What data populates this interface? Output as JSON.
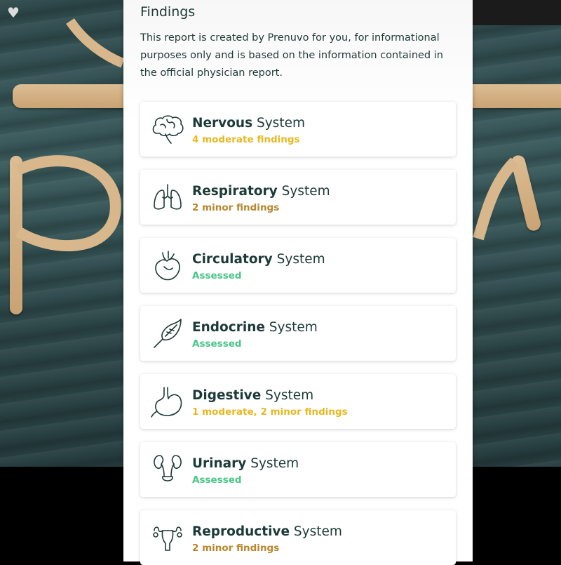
{
  "panel": {
    "title": "Findings",
    "description": "This report is created by Prenuvo for you, for informational purposes only and is based on the information contained in the official physician report."
  },
  "colors": {
    "moderate": "#e8b820",
    "minor": "#b8862c",
    "assessed": "#4cc58a",
    "text": "#1c3a37"
  },
  "systems": [
    {
      "name": "Nervous",
      "suffix": " System",
      "status": "4 moderate findings",
      "level": "moderate",
      "icon": "brain-icon"
    },
    {
      "name": "Respiratory",
      "suffix": " System",
      "status": "2 minor findings",
      "level": "minor",
      "icon": "lungs-icon"
    },
    {
      "name": "Circulatory",
      "suffix": " System",
      "status": "Assessed",
      "level": "assessed",
      "icon": "heart-icon"
    },
    {
      "name": "Endocrine",
      "suffix": " System",
      "status": "Assessed",
      "level": "assessed",
      "icon": "endocrine-icon"
    },
    {
      "name": "Digestive",
      "suffix": " System",
      "status": "1 moderate, 2 minor findings",
      "level": "moderate",
      "icon": "stomach-icon"
    },
    {
      "name": "Urinary",
      "suffix": " System",
      "status": "Assessed",
      "level": "assessed",
      "icon": "kidneys-icon"
    },
    {
      "name": "Reproductive",
      "suffix": " System",
      "status": "2 minor findings",
      "level": "minor",
      "icon": "uterus-icon"
    }
  ]
}
